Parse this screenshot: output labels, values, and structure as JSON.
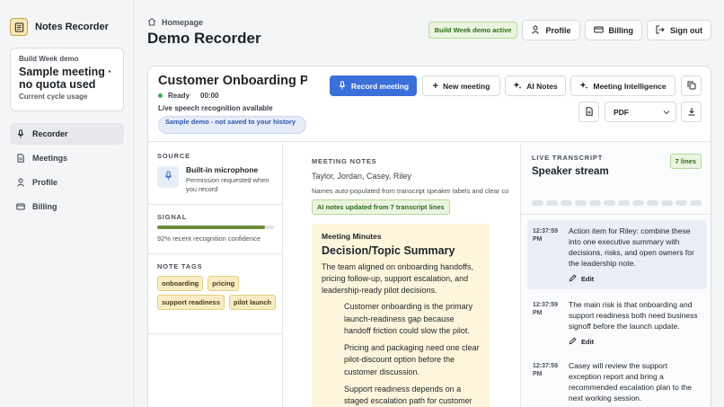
{
  "app": {
    "name": "Notes Recorder"
  },
  "plan": {
    "label": "Build Week demo",
    "title": "Sample meeting · no quota used",
    "subtitle": "Current cycle usage"
  },
  "sidebar": {
    "items": [
      {
        "label": "Recorder",
        "icon": "mic-icon",
        "active": true
      },
      {
        "label": "Meetings",
        "icon": "document-icon",
        "active": false
      },
      {
        "label": "Profile",
        "icon": "user-icon",
        "active": false
      },
      {
        "label": "Billing",
        "icon": "card-icon",
        "active": false
      }
    ]
  },
  "header": {
    "breadcrumb": "Homepage",
    "title": "Demo Recorder",
    "badge": "Build Week demo active",
    "profile_label": "Profile",
    "billing_label": "Billing",
    "signout_label": "Sign out"
  },
  "recorder": {
    "doc_title": "Customer Onboarding Pilot",
    "status": "Ready",
    "timer": "00:00",
    "speech_status": "Live speech recognition available",
    "demo_note": "Sample demo - not saved to your history",
    "record_label": "Record meeting",
    "new_meeting_label": "New meeting",
    "ai_notes_label": "AI Notes",
    "intelligence_label": "Meeting Intelligence",
    "export_format": "PDF"
  },
  "source": {
    "heading": "SOURCE",
    "title": "Built-in microphone",
    "subtitle": "Permission requested when you record"
  },
  "signal": {
    "heading": "SIGNAL",
    "confidence_value": 0.92,
    "confidence_text": "92% recent recognition confidence"
  },
  "note_tags": {
    "heading": "NOTE TAGS",
    "tags": [
      "onboarding",
      "pricing",
      "support readiness",
      "pilot launch"
    ]
  },
  "meeting_notes": {
    "heading": "MEETING NOTES",
    "participants": "Taylor, Jordan, Casey, Riley",
    "names_note": "Names auto-populated from transcript speaker labels and clear co",
    "ai_badge": "AI notes updated from 7 transcript lines",
    "minutes_title": "Meeting Minutes",
    "summary_heading": "Decision/Topic Summary",
    "summary_text": "The team aligned on onboarding handoffs, pricing follow-up, support escalation, and leadership-ready pilot decisions.",
    "bullets": [
      "Customer onboarding is the primary launch-readiness gap because handoff friction could slow the pilot.",
      "Pricing and packaging need one clear pilot-discount option before the customer discussion.",
      "Support readiness depends on a staged escalation path for customer"
    ]
  },
  "transcript": {
    "heading": "LIVE TRANSCRIPT",
    "title": "Speaker stream",
    "lines_badge": "7 lines",
    "edit_label": "Edit",
    "entries": [
      {
        "time": "12:37:59 PM",
        "text": "Action item for Riley: combine these into one executive summary with decisions, risks, and open owners for the leadership note."
      },
      {
        "time": "12:37:59 PM",
        "text": "The main risk is that onboarding and support readiness both need business signoff before the launch update."
      },
      {
        "time": "12:37:59 PM",
        "text": "Casey will review the support exception report and bring a recommended escalation plan to the next working session."
      }
    ]
  },
  "colors": {
    "primary": "#3b6fd9",
    "success_bg": "#eaf5df",
    "success_text": "#2f6a1e",
    "tag_bg": "#f7edc4",
    "minutes_bg": "#fdf6dc",
    "status_dot": "#3cae4d"
  }
}
